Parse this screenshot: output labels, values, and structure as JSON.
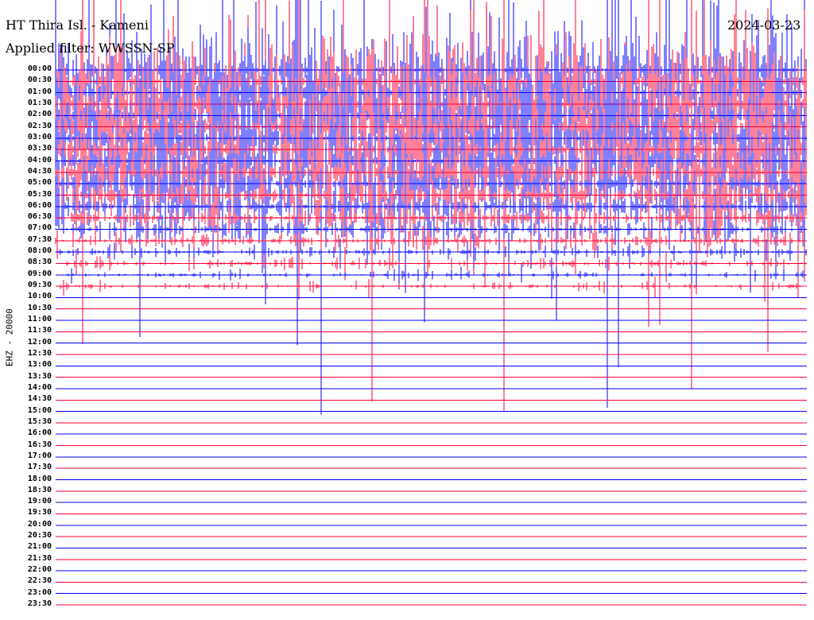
{
  "header": {
    "station": "HT Thira Isl. - Kameni",
    "filter": "Applied filter: WWSSN-SP",
    "date": "2024-03-23"
  },
  "chart_data": {
    "type": "line",
    "subtype": "helicorder",
    "channel_label": "EHZ - 20000",
    "row_labels": [
      "00:00",
      "00:30",
      "01:00",
      "01:30",
      "02:00",
      "02:30",
      "03:00",
      "03:30",
      "04:00",
      "04:30",
      "05:00",
      "05:30",
      "06:00",
      "06:30",
      "07:00",
      "07:30",
      "08:00",
      "08:30",
      "09:00",
      "09:30",
      "10:00",
      "10:30",
      "11:00",
      "11:30",
      "12:00",
      "12:30",
      "13:00",
      "13:30",
      "14:00",
      "14:30",
      "15:00",
      "15:30",
      "16:00",
      "16:30",
      "17:00",
      "17:30",
      "18:00",
      "18:30",
      "19:00",
      "19:30",
      "20:00",
      "20:30",
      "21:00",
      "21:30",
      "22:00",
      "22:30",
      "23:00",
      "23:30"
    ],
    "row_minutes": 30,
    "trace_colors": [
      "#0000ff",
      "#ff0033"
    ],
    "grid": false
  }
}
